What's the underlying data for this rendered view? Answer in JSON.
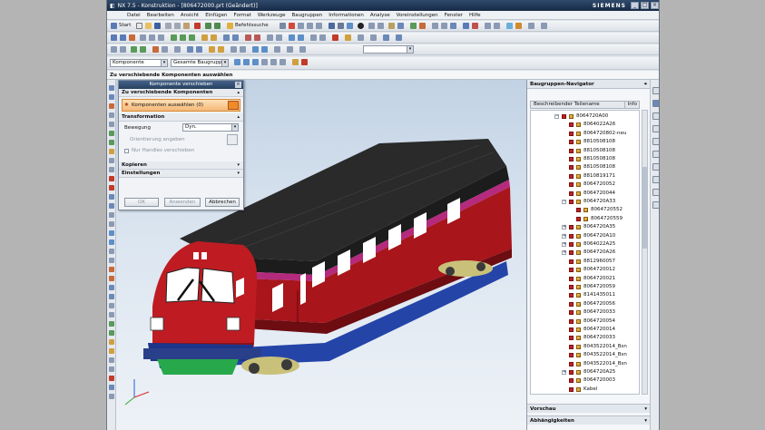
{
  "window": {
    "app_label": "NX 7.5",
    "title": "NX 7.5 - Konstruktion - [806472000.prt (Geändert)]",
    "brand": "SIEMENS",
    "controls": [
      "_",
      "□",
      "×"
    ]
  },
  "menu": [
    "Datei",
    "Bearbeiten",
    "Ansicht",
    "Einfügen",
    "Format",
    "Werkzeuge",
    "Baugruppen",
    "Informationen",
    "Analyse",
    "Voreinstellungen",
    "Fenster",
    "Hilfe"
  ],
  "toolbar": {
    "start_label": "Start",
    "command_search_label": "Befehlssuche"
  },
  "selection_bar": {
    "filter_value": "Komponente",
    "scope_value": "Gesamte Baugruppe"
  },
  "cue_line": "Zu verschiebende Komponenten auswählen",
  "dialog": {
    "title": "Komponente verschieben",
    "close": "×",
    "sections": {
      "components": "Zu verschiebende Komponenten",
      "transformation": "Transformation",
      "copy": "Kopieren",
      "settings": "Einstellungen"
    },
    "select_label": "Komponenten auswählen (0)",
    "motion_label": "Bewegung",
    "motion_value": "Dyn.",
    "orientation_label": "Orientierung angeben",
    "handles_label": "Nur Handles verschieben",
    "buttons": {
      "ok": "OK",
      "apply": "Anwenden",
      "cancel": "Abbrechen"
    }
  },
  "navigator": {
    "title": "Baugruppen-Navigator",
    "col_name": "Beschreibender Teilename",
    "col_info": "Info",
    "items": [
      {
        "label": "8064720A00",
        "level": 1,
        "toggle": "−"
      },
      {
        "label": "8064022A26",
        "level": 2,
        "toggle": ""
      },
      {
        "label": "8064720802-neu",
        "level": 2,
        "toggle": ""
      },
      {
        "label": "8810508108",
        "level": 2,
        "toggle": ""
      },
      {
        "label": "8810508108",
        "level": 2,
        "toggle": ""
      },
      {
        "label": "8810508108",
        "level": 2,
        "toggle": ""
      },
      {
        "label": "8810508108",
        "level": 2,
        "toggle": ""
      },
      {
        "label": "8810819171",
        "level": 2,
        "toggle": ""
      },
      {
        "label": "8064720052",
        "level": 2,
        "toggle": ""
      },
      {
        "label": "8064720044",
        "level": 2,
        "toggle": ""
      },
      {
        "label": "8064720A33",
        "level": 2,
        "toggle": "−"
      },
      {
        "label": "8064720552",
        "level": 3,
        "toggle": ""
      },
      {
        "label": "8064720559",
        "level": 3,
        "toggle": ""
      },
      {
        "label": "8064720A35",
        "level": 2,
        "toggle": "+"
      },
      {
        "label": "8064720A10",
        "level": 2,
        "toggle": "+"
      },
      {
        "label": "8064022A25",
        "level": 2,
        "toggle": "+"
      },
      {
        "label": "8064720A26",
        "level": 2,
        "toggle": "+"
      },
      {
        "label": "8812960057",
        "level": 2,
        "toggle": ""
      },
      {
        "label": "8064720012",
        "level": 2,
        "toggle": ""
      },
      {
        "label": "8064720021",
        "level": 2,
        "toggle": ""
      },
      {
        "label": "8064720059",
        "level": 2,
        "toggle": ""
      },
      {
        "label": "8141435011",
        "level": 2,
        "toggle": ""
      },
      {
        "label": "8064720056",
        "level": 2,
        "toggle": ""
      },
      {
        "label": "8064720033",
        "level": 2,
        "toggle": ""
      },
      {
        "label": "8064720054",
        "level": 2,
        "toggle": ""
      },
      {
        "label": "8064720014",
        "level": 2,
        "toggle": ""
      },
      {
        "label": "8064720033",
        "level": 2,
        "toggle": ""
      },
      {
        "label": "8043522014_Bsn",
        "level": 2,
        "toggle": ""
      },
      {
        "label": "8043522014_Bsn",
        "level": 2,
        "toggle": ""
      },
      {
        "label": "8043522014_Bsn",
        "level": 2,
        "toggle": ""
      },
      {
        "label": "8064720A25",
        "level": 2,
        "toggle": "+"
      },
      {
        "label": "8064720003",
        "level": 2,
        "toggle": ""
      },
      {
        "label": "Kabel",
        "level": 2,
        "toggle": ""
      }
    ],
    "preview": "Vorschau",
    "dependencies": "Abhängigkeiten"
  },
  "colors": {
    "train_body": "#b3161d",
    "train_roof": "#2a2a2a",
    "underframe": "#2444a8",
    "bogie": "#d8cf6a",
    "selection_orange": "#f6b877"
  }
}
